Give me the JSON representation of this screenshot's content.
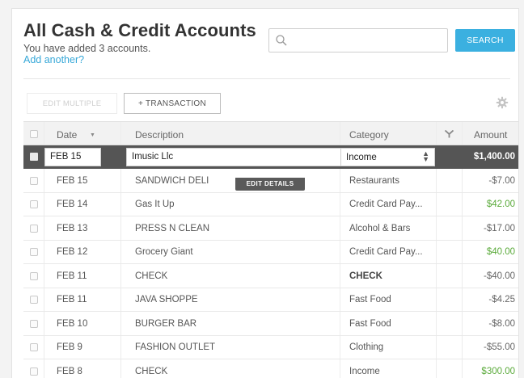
{
  "header": {
    "title": "All Cash & Credit Accounts",
    "subtitle": "You have added 3 accounts.",
    "add_link": "Add another?"
  },
  "search": {
    "placeholder": "",
    "button_label": "SEARCH"
  },
  "toolbar": {
    "edit_multiple": "EDIT MULTIPLE",
    "add_transaction": "+ TRANSACTION"
  },
  "table": {
    "columns": {
      "date": "Date",
      "description": "Description",
      "category": "Category",
      "amount": "Amount"
    },
    "selected_row": {
      "date": "FEB 15",
      "description": "Imusic Llc",
      "category": "Income",
      "amount": "$1,400.00"
    },
    "edit_details_label": "EDIT DETAILS",
    "rows": [
      {
        "date": "FEB 15",
        "description": "SANDWICH DELI",
        "category": "Restaurants",
        "amount": "-$7.00"
      },
      {
        "date": "FEB 14",
        "description": "Gas It Up",
        "category": "Credit Card Pay...",
        "amount": "$42.00"
      },
      {
        "date": "FEB 13",
        "description": "PRESS N CLEAN",
        "category": "Alcohol & Bars",
        "amount": "-$17.00"
      },
      {
        "date": "FEB 12",
        "description": "Grocery Giant",
        "category": "Credit Card Pay...",
        "amount": "$40.00"
      },
      {
        "date": "FEB 11",
        "description": "CHECK",
        "category": "CHECK",
        "amount": "-$40.00"
      },
      {
        "date": "FEB 11",
        "description": "JAVA SHOPPE",
        "category": "Fast Food",
        "amount": "-$4.25"
      },
      {
        "date": "FEB 10",
        "description": "BURGER BAR",
        "category": "Fast Food",
        "amount": "-$8.00"
      },
      {
        "date": "FEB 9",
        "description": "FASHION OUTLET",
        "category": "Clothing",
        "amount": "-$55.00"
      },
      {
        "date": "FEB 8",
        "description": "CHECK",
        "category": "Income",
        "amount": "$300.00"
      }
    ]
  },
  "colors": {
    "accent": "#3bb0e0",
    "positive_amount": "#5aaa3a",
    "selected_row": "#555555"
  },
  "icons": [
    "search-icon",
    "gear-icon",
    "filter-icon",
    "sort-caret-icon",
    "select-arrows-icon"
  ]
}
